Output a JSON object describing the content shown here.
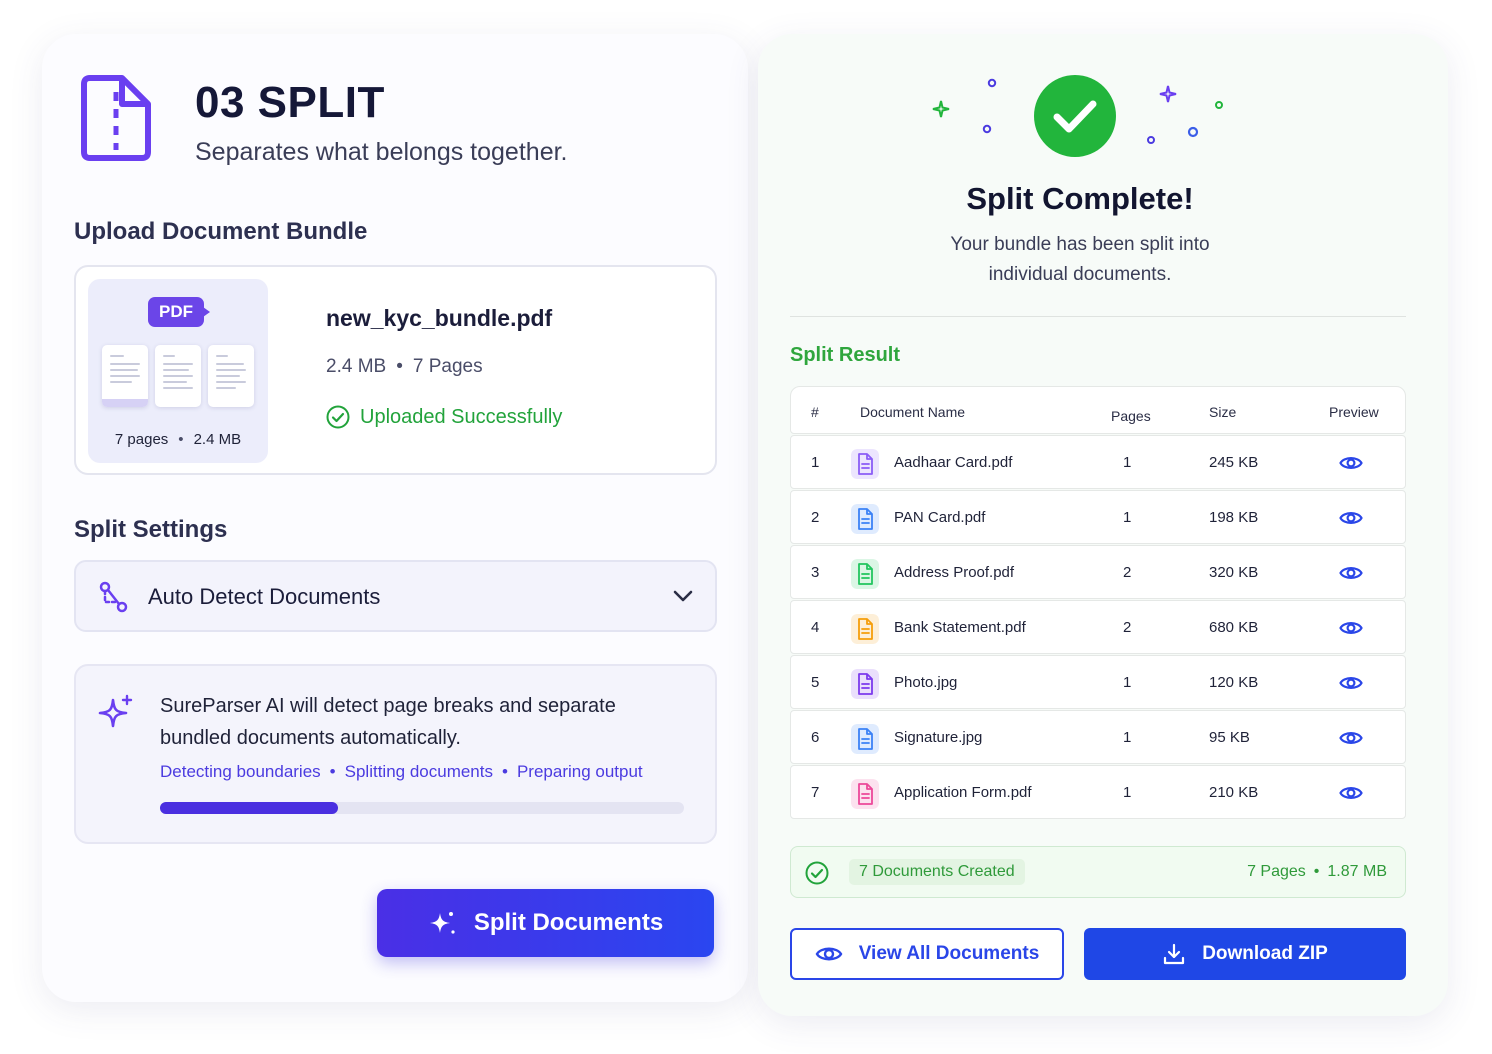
{
  "left": {
    "title": "03 SPLIT",
    "subtitle": "Separates what belongs together.",
    "upload": {
      "section_title": "Upload Document Bundle",
      "badge": "PDF",
      "thumb_pages": "7 pages",
      "thumb_size": "2.4 MB",
      "file_name": "new_kyc_bundle.pdf",
      "file_size": "2.4 MB",
      "file_pages": "7 Pages",
      "status": "Uploaded Successfully"
    },
    "settings": {
      "section_title": "Split Settings",
      "select_value": "Auto Detect Documents"
    },
    "ai": {
      "text": "SureParser AI will detect page breaks and separate bundled documents automatically.",
      "steps": [
        "Detecting boundaries",
        "Splitting documents",
        "Preparing output"
      ],
      "progress": 0.34
    },
    "split_button": "Split Documents"
  },
  "right": {
    "title": "Split Complete!",
    "subtitle": "Your bundle has been split into individual documents.",
    "result_title": "Split Result",
    "table": {
      "headers": {
        "num": "#",
        "name": "Document Name",
        "pages": "Pages",
        "size": "Size",
        "preview": "Preview"
      },
      "rows": [
        {
          "num": "1",
          "name": "Aadhaar Card.pdf",
          "pages": "1",
          "size": "245 KB",
          "color": "#8b5cf6"
        },
        {
          "num": "2",
          "name": "PAN Card.pdf",
          "pages": "1",
          "size": "198 KB",
          "color": "#3b82f6"
        },
        {
          "num": "3",
          "name": "Address Proof.pdf",
          "pages": "2",
          "size": "320 KB",
          "color": "#22c55e"
        },
        {
          "num": "4",
          "name": "Bank Statement.pdf",
          "pages": "2",
          "size": "680 KB",
          "color": "#f59e0b"
        },
        {
          "num": "5",
          "name": "Photo.jpg",
          "pages": "1",
          "size": "120 KB",
          "color": "#7c3aed"
        },
        {
          "num": "6",
          "name": "Signature.jpg",
          "pages": "1",
          "size": "95 KB",
          "color": "#3b82f6"
        },
        {
          "num": "7",
          "name": "Application Form.pdf",
          "pages": "1",
          "size": "210 KB",
          "color": "#ec4899"
        }
      ]
    },
    "summary": {
      "docs_created": "7 Documents Created",
      "pages": "7 Pages",
      "size": "1.87 MB"
    },
    "view_all_button": "View All Documents",
    "download_button": "Download ZIP"
  },
  "colors": {
    "primary": "#4a2fe6",
    "success": "#22a33b",
    "download": "#1f47e6"
  }
}
